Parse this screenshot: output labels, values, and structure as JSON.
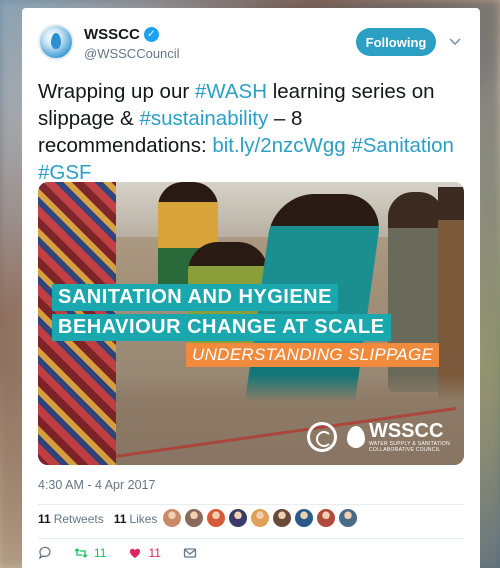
{
  "tweet": {
    "author_name": "WSSCC",
    "author_handle": "@WSSCCouncil",
    "follow_label": "Following",
    "text_parts": [
      {
        "text": "Wrapping up our ",
        "type": "plain"
      },
      {
        "text": "#WASH",
        "type": "tag"
      },
      {
        "text": " learning series on slippage & ",
        "type": "plain"
      },
      {
        "text": "#sustainability",
        "type": "tag"
      },
      {
        "text": " – 8 recommendations: ",
        "type": "plain"
      },
      {
        "text": "bit.ly/2nzcWgg",
        "type": "tag"
      },
      {
        "text": " ",
        "type": "plain"
      },
      {
        "text": "#Sanitation",
        "type": "tag"
      },
      {
        "text": " ",
        "type": "plain"
      },
      {
        "text": "#GSF",
        "type": "tag"
      }
    ],
    "media": {
      "line1": "SANITATION AND HYGIENE",
      "line2": "BEHAVIOUR CHANGE AT SCALE",
      "line3": "UNDERSTANDING SLIPPAGE",
      "logo_text": "WSSCC",
      "logo_sub1": "WATER SUPPLY & SANITATION",
      "logo_sub2": "COLLABORATIVE COUNCIL",
      "banner_teal": "#1aa7ae",
      "banner_orange": "#f08a3c"
    },
    "timestamp": "4:30 AM - 4 Apr 2017",
    "retweets_count": "11",
    "retweets_label": "Retweets",
    "likes_count": "11",
    "likes_label": "Likes",
    "action_retweet_count": "11",
    "action_like_count": "11",
    "liker_colors": [
      "#c98a6a",
      "#8a6a5a",
      "#d95a3a",
      "#3a3a6a",
      "#e0a05a",
      "#6a4a3a",
      "#2a5a8a",
      "#b04a3a",
      "#4a6a8a"
    ],
    "accent": "#2b9fc4",
    "like_color": "#e0245e",
    "retweet_color": "#17bf63"
  }
}
